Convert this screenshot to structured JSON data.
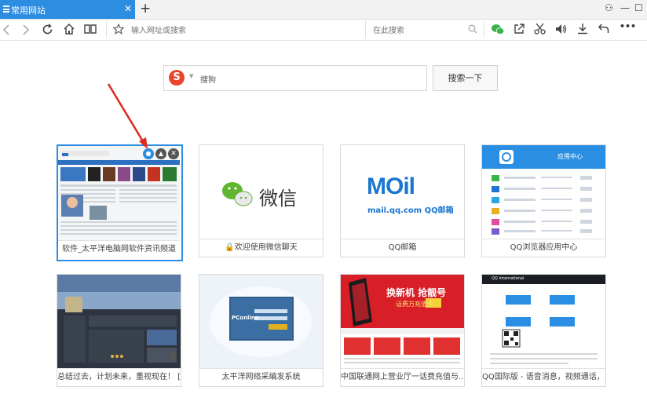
{
  "tab": {
    "title": "常用网站",
    "close_glyph": "✕"
  },
  "newtab_glyph": "+",
  "window": {
    "user": "⚇",
    "minimize": "—",
    "maximize": "☐"
  },
  "toolbar": {
    "url_placeholder": "输入网址或搜索",
    "search_placeholder": "在此搜索",
    "more": "•••"
  },
  "search": {
    "engine_logo": "S",
    "engine_name": "搜狗",
    "button_label": "搜索一下"
  },
  "tiles": [
    {
      "caption": "软件_太平洋电脑网软件资讯频道",
      "thumb": "pconline-software"
    },
    {
      "caption": "欢迎使用微信聊天",
      "thumb": "wechat",
      "lock": true
    },
    {
      "caption": "QQ邮箱",
      "thumb": "qqmail"
    },
    {
      "caption": "QQ浏览器应用中心",
      "thumb": "appcenter"
    },
    {
      "caption": "总结过去，计划未来，重视现在！ [...",
      "thumb": "dark-site"
    },
    {
      "caption": "太平洋网络采编发系统",
      "thumb": "pconline-cms"
    },
    {
      "caption": "中国联通网上营业厅一话费充值与...",
      "thumb": "unicom"
    },
    {
      "caption": "QQ国际版 - 语音消息，视频通话，...",
      "thumb": "qq-intl"
    }
  ],
  "thumb_text": {
    "wechat_word": "微信",
    "mail_logo": "MOil",
    "mail_url": "mail.qq.com QQ邮箱",
    "appcenter_title": "应用中心",
    "unicom_ad1": "换新机 抢靓号",
    "unicom_ad2": "话费万充值卡",
    "pconline_logo": "PConline",
    "qq_intl_title": "QQ International"
  },
  "colors": {
    "accent": "#2d8de0",
    "arrow": "#e0281e",
    "sogou": "#e8452c"
  }
}
